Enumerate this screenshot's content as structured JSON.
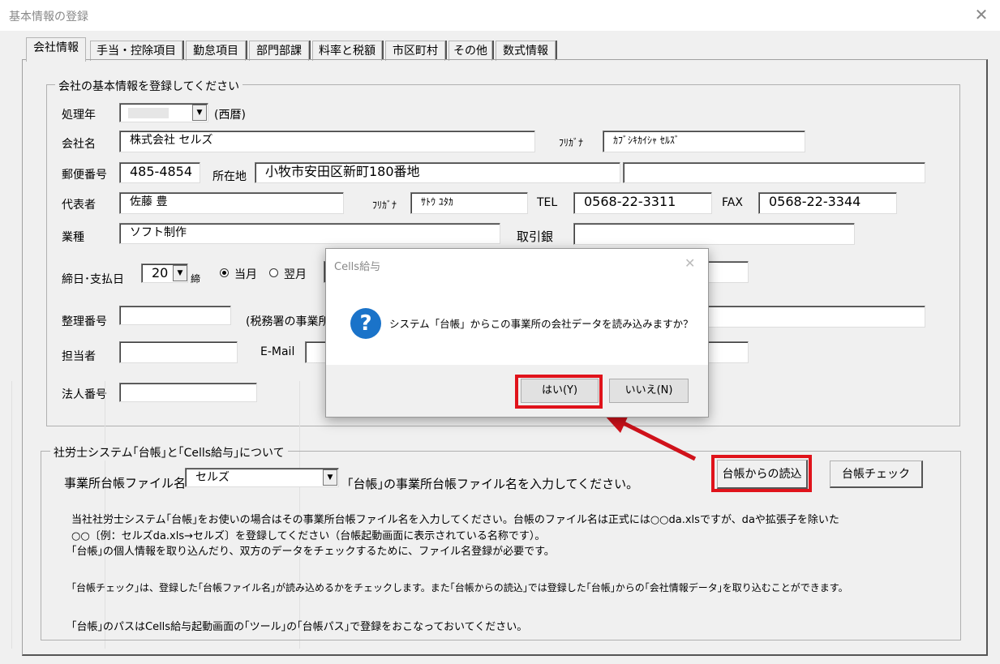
{
  "window": {
    "title": "基本情報の登録",
    "close_label": "✕"
  },
  "tabs": [
    "会社情報",
    "手当・控除項目",
    "勤怠項目",
    "部門部課",
    "料率と税額",
    "市区町村",
    "その他",
    "数式情報"
  ],
  "company": {
    "group_title": "会社の基本情報を登録してください",
    "year_label": "処理年",
    "year_value": "",
    "year_note": "(西暦)",
    "name_label": "会社名",
    "name_value": "株式会社 セルズ",
    "furigana_label": "ﾌﾘｶﾞﾅ",
    "name_kana": "ｶﾌﾞｼｷｶｲｼｬ ｾﾙｽﾞ",
    "postal_label": "郵便番号",
    "postal_value": "485-4854",
    "address_label": "所在地",
    "address_value": "小牧市安田区新町180番地",
    "address2_value": "",
    "rep_label": "代表者",
    "rep_value": "佐藤 豊",
    "rep_furigana_label": "ﾌﾘｶﾞﾅ",
    "rep_kana": "ｻﾄｳ ﾕﾀｶ",
    "tel_label": "TEL",
    "tel_value": "0568-22-3311",
    "fax_label": "FAX",
    "fax_value": "0568-22-3344",
    "industry_label": "業種",
    "industry_value": "ソフト制作",
    "bank_label": "取引銀",
    "bank_value": "",
    "closing_label": "締日･支払日",
    "closing_day": "20",
    "closing_suffix": "締",
    "radio_current": "当月",
    "radio_next": "翌月",
    "seiri_label": "整理番号",
    "seiri_note": "(税務署の事業所",
    "tanto_label": "担当者",
    "email_label": "E-Mail",
    "corp_label": "法人番号"
  },
  "sharoushi": {
    "group_title": "社労士システム｢台帳｣と｢Cells給与｣について",
    "file_label": "事業所台帳ファイル名",
    "file_value": "セルズ",
    "file_hint": "｢台帳｣の事業所台帳ファイル名を入力してください。",
    "read_button": "台帳からの読込",
    "check_button": "台帳チェック",
    "para1_line1": "当社社労士システム｢台帳｣をお使いの場合はその事業所台帳ファイル名を入力してください。台帳のファイル名は正式には○○da.xlsですが、daや拡張子を除いた",
    "para1_line2": "○○〔例：セルズda.xls→セルズ〕を登録してください（台帳起動画面に表示されている名称です）。",
    "para1_line3": "｢台帳｣の個人情報を取り込んだり、双方のデータをチェックするために、ファイル名登録が必要です。",
    "para2": "｢台帳チェック｣は、登録した｢台帳ファイル名｣が読み込めるかをチェックします。また｢台帳からの読込｣では登録した｢台帳｣からの｢会社情報データ｣を取り込むことができます。",
    "para3": "｢台帳｣のパスはCells給与起動画面の｢ツール｣の｢台帳パス｣で登録をおこなっておいてください。"
  },
  "dialog": {
    "title": "Cells給与",
    "message": "システム「台帳」からこの事業所の会社データを読み込みますか？",
    "yes_label": "はい(Y)",
    "no_label": "いいえ(N)",
    "icon_glyph": "?"
  },
  "colors": {
    "highlight": "#e0131b",
    "question_icon": "#1a73c9"
  }
}
